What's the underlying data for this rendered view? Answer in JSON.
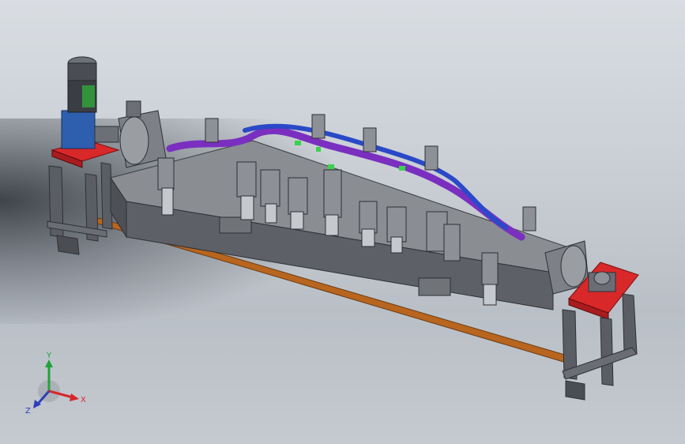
{
  "window": {
    "title": ""
  },
  "axes": {
    "x_label": "X",
    "y_label": "Y",
    "z_label": "Z",
    "x_color": "#d8262a",
    "y_color": "#21a23a",
    "z_color": "#2d3fb8"
  },
  "colors": {
    "bed": "#7a7d82",
    "frame": "#4b4f55",
    "red_plate": "#d9282a",
    "orange_bar": "#b8651f",
    "purple_part": "#7a2fc0",
    "blue_part": "#2a49c8",
    "green_part": "#39d24a",
    "motor_blue": "#2d5fae",
    "background_top": "#d9dde2"
  }
}
